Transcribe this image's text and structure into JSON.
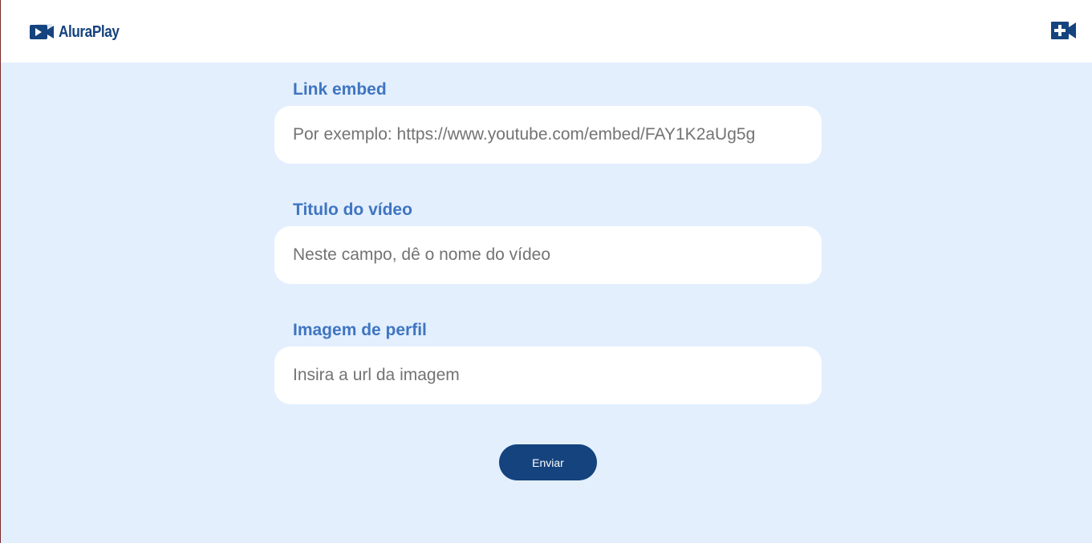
{
  "header": {
    "logo_text": "AluraPlay",
    "add_video_icon": "video-camera-plus-icon"
  },
  "form": {
    "fields": [
      {
        "label": "Link embed",
        "placeholder": "Por exemplo: https://www.youtube.com/embed/FAY1K2aUg5g",
        "value": ""
      },
      {
        "label": "Titulo do vídeo",
        "placeholder": "Neste campo, dê o nome do vídeo",
        "value": ""
      },
      {
        "label": "Imagem de perfil",
        "placeholder": "Insira a url da imagem",
        "value": ""
      }
    ],
    "submit_label": "Enviar"
  },
  "colors": {
    "background": "#e3effd",
    "header": "#ffffff",
    "brand": "#14437e",
    "label": "#3f75c1",
    "input": "#ffffff",
    "placeholder": "#737373"
  }
}
